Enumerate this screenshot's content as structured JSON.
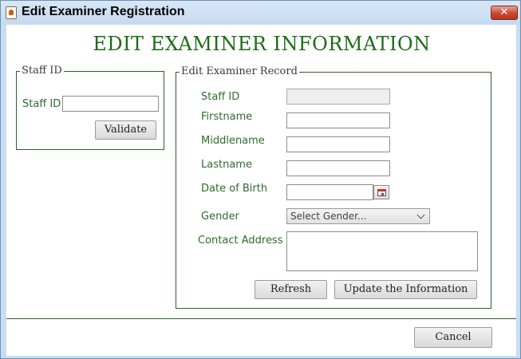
{
  "window": {
    "title": "Edit Examiner Registration",
    "close_symbol": "✕"
  },
  "heading": "EDIT EXAMINER INFORMATION",
  "staff_panel": {
    "legend": "Staff ID",
    "staff_id_label": "Staff ID",
    "staff_id_value": "",
    "validate_label": "Validate"
  },
  "record_panel": {
    "legend": "Edit Examiner Record",
    "staff_id_label": "Staff ID",
    "staff_id_value": "",
    "firstname_label": "Firstname",
    "firstname_value": "",
    "middlename_label": "Middlename",
    "middlename_value": "",
    "lastname_label": "Lastname",
    "lastname_value": "",
    "dob_label": "Date of Birth",
    "dob_value": "",
    "gender_label": "Gender",
    "gender_selected": "Select Gender...",
    "address_label": "Contact Address",
    "address_value": "",
    "refresh_label": "Refresh",
    "update_label": "Update the Information"
  },
  "footer": {
    "cancel_label": "Cancel"
  },
  "colors": {
    "accent_green": "#1d6b17",
    "label_green": "#2f6b2a",
    "title_bar": "#c9ddf2",
    "close_red": "#c7472f"
  },
  "icons": [
    "java-app-icon",
    "close-icon",
    "calendar-icon",
    "chevron-down-icon"
  ]
}
